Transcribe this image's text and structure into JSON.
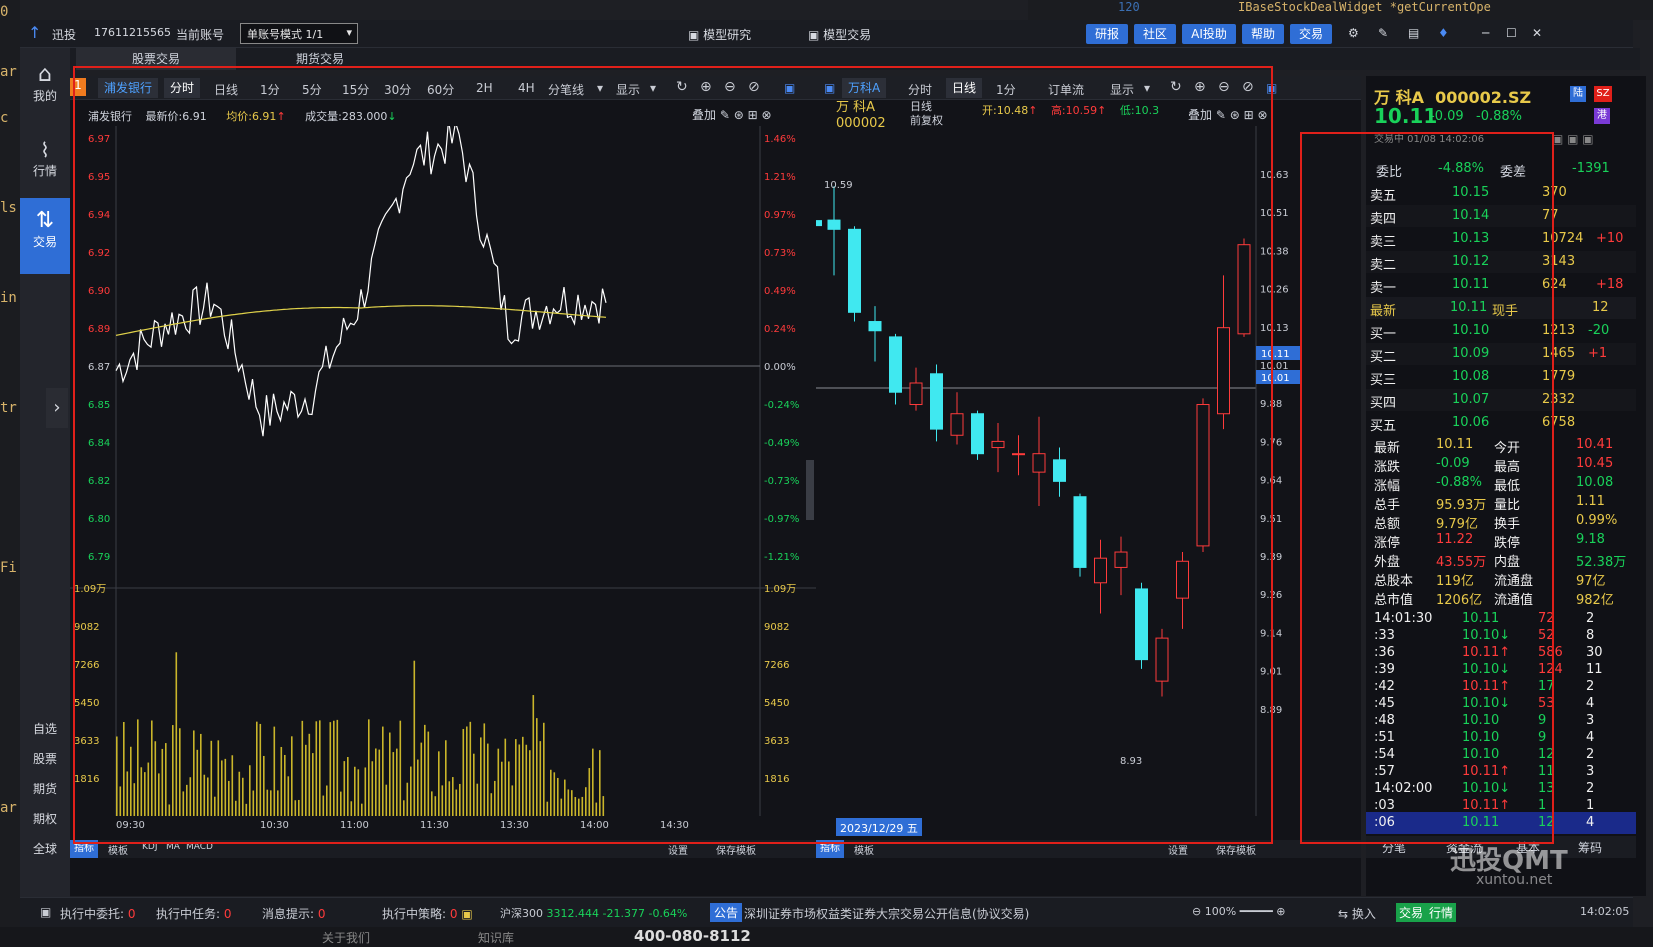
{
  "app": {
    "name": "迅投",
    "account": "17611215565",
    "account_label": "当前账号",
    "mode": "单账号模式 1/1",
    "center_tabs": [
      "模型研究",
      "模型交易"
    ],
    "top_buttons": [
      "研报",
      "社区",
      "AI投助",
      "帮助",
      "交易"
    ]
  },
  "nav": {
    "top": [
      "我的",
      "行情",
      "交易"
    ],
    "bottom": [
      "自选",
      "股票",
      "期货",
      "期权",
      "全球"
    ]
  },
  "subtabs": [
    "股票交易",
    "期货交易"
  ],
  "chart1": {
    "toolbar": [
      "浦发银行",
      "分时",
      "日线",
      "1分",
      "5分",
      "15分",
      "30分",
      "60分",
      "2H",
      "4H",
      "分笔线",
      "显示"
    ],
    "info": {
      "name": "浦发银行",
      "last_label": "最新价:",
      "last": "6.91",
      "avg_label": "均价:",
      "avg": "6.91",
      "vol_label": "成交量:",
      "vol": "283.000"
    },
    "overlay": "叠加",
    "y_left": [
      "6.97",
      "6.95",
      "6.94",
      "6.92",
      "6.90",
      "6.89",
      "6.87",
      "6.85",
      "6.84",
      "6.82",
      "6.80",
      "6.79"
    ],
    "y_right": [
      "1.46%",
      "1.21%",
      "0.97%",
      "0.73%",
      "0.49%",
      "0.24%",
      "0.00%",
      "-0.24%",
      "-0.49%",
      "-0.73%",
      "-0.97%",
      "-1.21%"
    ],
    "vol_left": [
      "1.09万",
      "9082",
      "7266",
      "5450",
      "3633",
      "1816"
    ],
    "vol_right": [
      "1.09万",
      "9082",
      "7266",
      "5450",
      "3633",
      "1816"
    ],
    "x": [
      "09:30",
      "10:30",
      "11:00",
      "11:30",
      "13:30",
      "14:00",
      "14:30"
    ],
    "bottom_tabs": [
      "指标",
      "模板",
      "KDJ",
      "MA",
      "MACD"
    ],
    "bottom_right": [
      "设置",
      "保存模板"
    ]
  },
  "chart2": {
    "toolbar": [
      "万科A",
      "分时",
      "日线",
      "1分",
      "订单流",
      "显示"
    ],
    "name": "万 科A",
    "code": "000002",
    "period": "日线",
    "adj": "前复权",
    "open_label": "开:",
    "open": "10.48",
    "high_label": "高:",
    "high": "10.59",
    "low_label": "低:",
    "low": "10.3",
    "overlay": "叠加",
    "y": [
      "10.63",
      "10.51",
      "10.38",
      "10.26",
      "10.13",
      "10.01",
      "9.88",
      "9.76",
      "9.64",
      "9.51",
      "9.39",
      "9.26",
      "9.14",
      "9.01",
      "8.89"
    ],
    "max_label": "10.59",
    "min_label": "8.93",
    "cur_tag": "10.11",
    "cur_tag2": "10.01",
    "date": "2023/12/29 五",
    "bottom_tabs": [
      "指标",
      "模板"
    ],
    "bottom_right": [
      "设置",
      "保存模板"
    ]
  },
  "chart_data": {
    "type": "line",
    "title": "",
    "x": [
      "09:30",
      "10:30",
      "11:00",
      "11:30",
      "13:30",
      "14:00",
      "14:30"
    ],
    "ylim": [
      6.79,
      6.97
    ],
    "series": [
      {
        "values": [
          6.87,
          6.89,
          6.9,
          6.85,
          6.86,
          6.9,
          6.96,
          6.97,
          6.89,
          6.9,
          6.9
        ]
      }
    ]
  },
  "quote": {
    "name": "万 科A",
    "code": "000002.SZ",
    "price": "10.11",
    "chg": "-0.09",
    "pct": "-0.88%",
    "time": "交易中 01/08 14:02:06",
    "tags": [
      "陆",
      "SZ",
      "港"
    ],
    "wb_label": "委比",
    "wb": "-4.88%",
    "wc_label": "委差",
    "wc": "-1391",
    "asks": [
      [
        "卖五",
        "10.15",
        "370",
        ""
      ],
      [
        "卖四",
        "10.14",
        "77",
        ""
      ],
      [
        "卖三",
        "10.13",
        "10724",
        "+10"
      ],
      [
        "卖二",
        "10.12",
        "3143",
        ""
      ],
      [
        "卖一",
        "10.11",
        "624",
        "+18"
      ]
    ],
    "last": [
      "最新",
      "10.11",
      "现手",
      "12"
    ],
    "bids": [
      [
        "买一",
        "10.10",
        "1213",
        "-20"
      ],
      [
        "买二",
        "10.09",
        "1465",
        "+1"
      ],
      [
        "买三",
        "10.08",
        "1779",
        ""
      ],
      [
        "买四",
        "10.07",
        "2332",
        ""
      ],
      [
        "买五",
        "10.06",
        "6758",
        ""
      ]
    ],
    "stats": [
      [
        "最新",
        "10.11",
        "今开",
        "10.41"
      ],
      [
        "涨跌",
        "-0.09",
        "最高",
        "10.45"
      ],
      [
        "涨幅",
        "-0.88%",
        "最低",
        "10.08"
      ],
      [
        "总手",
        "95.93万",
        "量比",
        "1.11"
      ],
      [
        "总额",
        "9.79亿",
        "换手",
        "0.99%"
      ],
      [
        "涨停",
        "11.22",
        "跌停",
        "9.18"
      ],
      [
        "外盘",
        "43.55万",
        "内盘",
        "52.38万"
      ],
      [
        "总股本",
        "119亿",
        "流通盘",
        "97亿"
      ],
      [
        "总市值",
        "1206亿",
        "流通值",
        "982亿"
      ]
    ],
    "ticks": [
      [
        "14:01:30",
        "10.11",
        "",
        "72",
        "2"
      ],
      [
        ":33",
        "10.10",
        "↓",
        "52",
        "8"
      ],
      [
        ":36",
        "10.11",
        "↑",
        "586",
        "30"
      ],
      [
        ":39",
        "10.10",
        "↓",
        "124",
        "11"
      ],
      [
        ":42",
        "10.11",
        "↑",
        "17",
        "2"
      ],
      [
        ":45",
        "10.10",
        "↓",
        "53",
        "4"
      ],
      [
        ":48",
        "10.10",
        "",
        "9",
        "3"
      ],
      [
        ":51",
        "10.10",
        "",
        "9",
        "4"
      ],
      [
        ":54",
        "10.10",
        "",
        "12",
        "2"
      ],
      [
        ":57",
        "10.11",
        "↑",
        "11",
        "3"
      ],
      [
        "14:02:00",
        "10.10",
        "↓",
        "13",
        "2"
      ],
      [
        ":03",
        "10.11",
        "↑",
        "1",
        "1"
      ],
      [
        ":06",
        "10.11",
        "",
        "12",
        "4"
      ]
    ],
    "bottom_tabs": [
      "分笔",
      "资金流",
      "基本",
      "筹码"
    ]
  },
  "status": {
    "items": [
      "执行中委托:",
      "0",
      "执行中任务:",
      "0",
      "消息提示:",
      "0",
      "执行中策略:",
      "0"
    ],
    "index_name": "沪深300",
    "index_val": "3312.444",
    "index_chg": "-21.377",
    "index_pct": "-0.64%",
    "notice_label": "公告",
    "notice": "深圳证券市场权益类证券大宗交易公开信息(协议交易)",
    "zoom": "100%",
    "right": [
      "换入",
      "交易",
      "行情"
    ],
    "time": "14:02:05"
  },
  "footer": {
    "links": [
      "关于我们",
      "知识库"
    ],
    "phone": "400-080-8112"
  },
  "watermark": "迅投QMT",
  "watermark2": "xuntou.net"
}
